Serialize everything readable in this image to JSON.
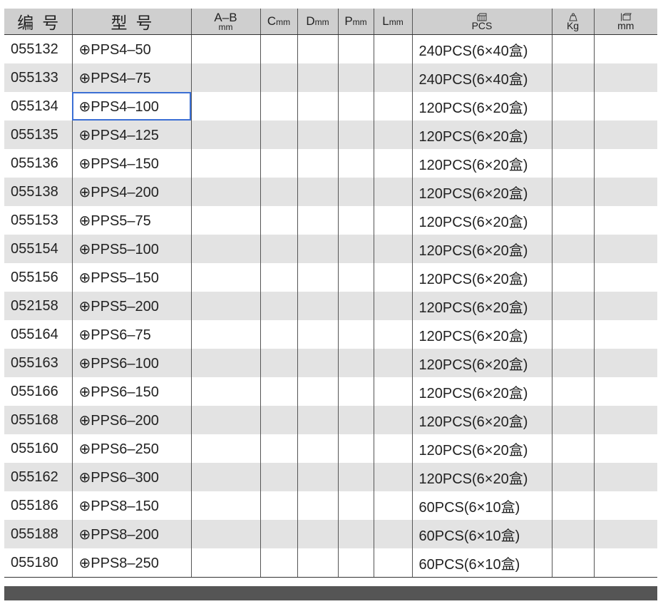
{
  "table": {
    "headers": {
      "code": "编号",
      "model": "型号",
      "ab_top": "A–B",
      "ab_unit": "mm",
      "c_letter": "C",
      "c_unit": "mm",
      "d_letter": "D",
      "d_unit": "mm",
      "p_letter": "P",
      "p_unit": "mm",
      "l_letter": "L",
      "l_unit": "mm",
      "pcs_icon": "box-icon",
      "pcs_label": "PCS",
      "kg_icon": "weight-icon",
      "kg_label": "Kg",
      "mm_icon": "carton-size-icon",
      "mm_label": "mm"
    },
    "selected_row_index": 2,
    "rows": [
      {
        "code": "055132",
        "model": "⊕PPS4–50",
        "pcs": "240PCS(6×40盒)"
      },
      {
        "code": "055133",
        "model": "⊕PPS4–75",
        "pcs": "240PCS(6×40盒)"
      },
      {
        "code": "055134",
        "model": "⊕PPS4–100",
        "pcs": "120PCS(6×20盒)"
      },
      {
        "code": "055135",
        "model": "⊕PPS4–125",
        "pcs": "120PCS(6×20盒)"
      },
      {
        "code": "055136",
        "model": "⊕PPS4–150",
        "pcs": "120PCS(6×20盒)"
      },
      {
        "code": "055138",
        "model": "⊕PPS4–200",
        "pcs": "120PCS(6×20盒)"
      },
      {
        "code": "055153",
        "model": "⊕PPS5–75",
        "pcs": "120PCS(6×20盒)"
      },
      {
        "code": "055154",
        "model": "⊕PPS5–100",
        "pcs": "120PCS(6×20盒)"
      },
      {
        "code": "055156",
        "model": "⊕PPS5–150",
        "pcs": "120PCS(6×20盒)"
      },
      {
        "code": "052158",
        "model": "⊕PPS5–200",
        "pcs": "120PCS(6×20盒)"
      },
      {
        "code": "055164",
        "model": "⊕PPS6–75",
        "pcs": "120PCS(6×20盒)"
      },
      {
        "code": "055163",
        "model": "⊕PPS6–100",
        "pcs": "120PCS(6×20盒)"
      },
      {
        "code": "055166",
        "model": "⊕PPS6–150",
        "pcs": "120PCS(6×20盒)"
      },
      {
        "code": "055168",
        "model": "⊕PPS6–200",
        "pcs": "120PCS(6×20盒)"
      },
      {
        "code": "055160",
        "model": "⊕PPS6–250",
        "pcs": "120PCS(6×20盒)"
      },
      {
        "code": "055162",
        "model": "⊕PPS6–300",
        "pcs": "120PCS(6×20盒)"
      },
      {
        "code": "055186",
        "model": "⊕PPS8–150",
        "pcs": "60PCS(6×10盒)"
      },
      {
        "code": "055188",
        "model": "⊕PPS8–200",
        "pcs": "60PCS(6×10盒)"
      },
      {
        "code": "055180",
        "model": "⊕PPS8–250",
        "pcs": "60PCS(6×10盒)"
      }
    ]
  },
  "colors": {
    "header_bg": "#cfcfcf",
    "alt_row_bg": "#e3e3e3",
    "selection": "#3b6fd4",
    "footer_bar": "#555555"
  }
}
